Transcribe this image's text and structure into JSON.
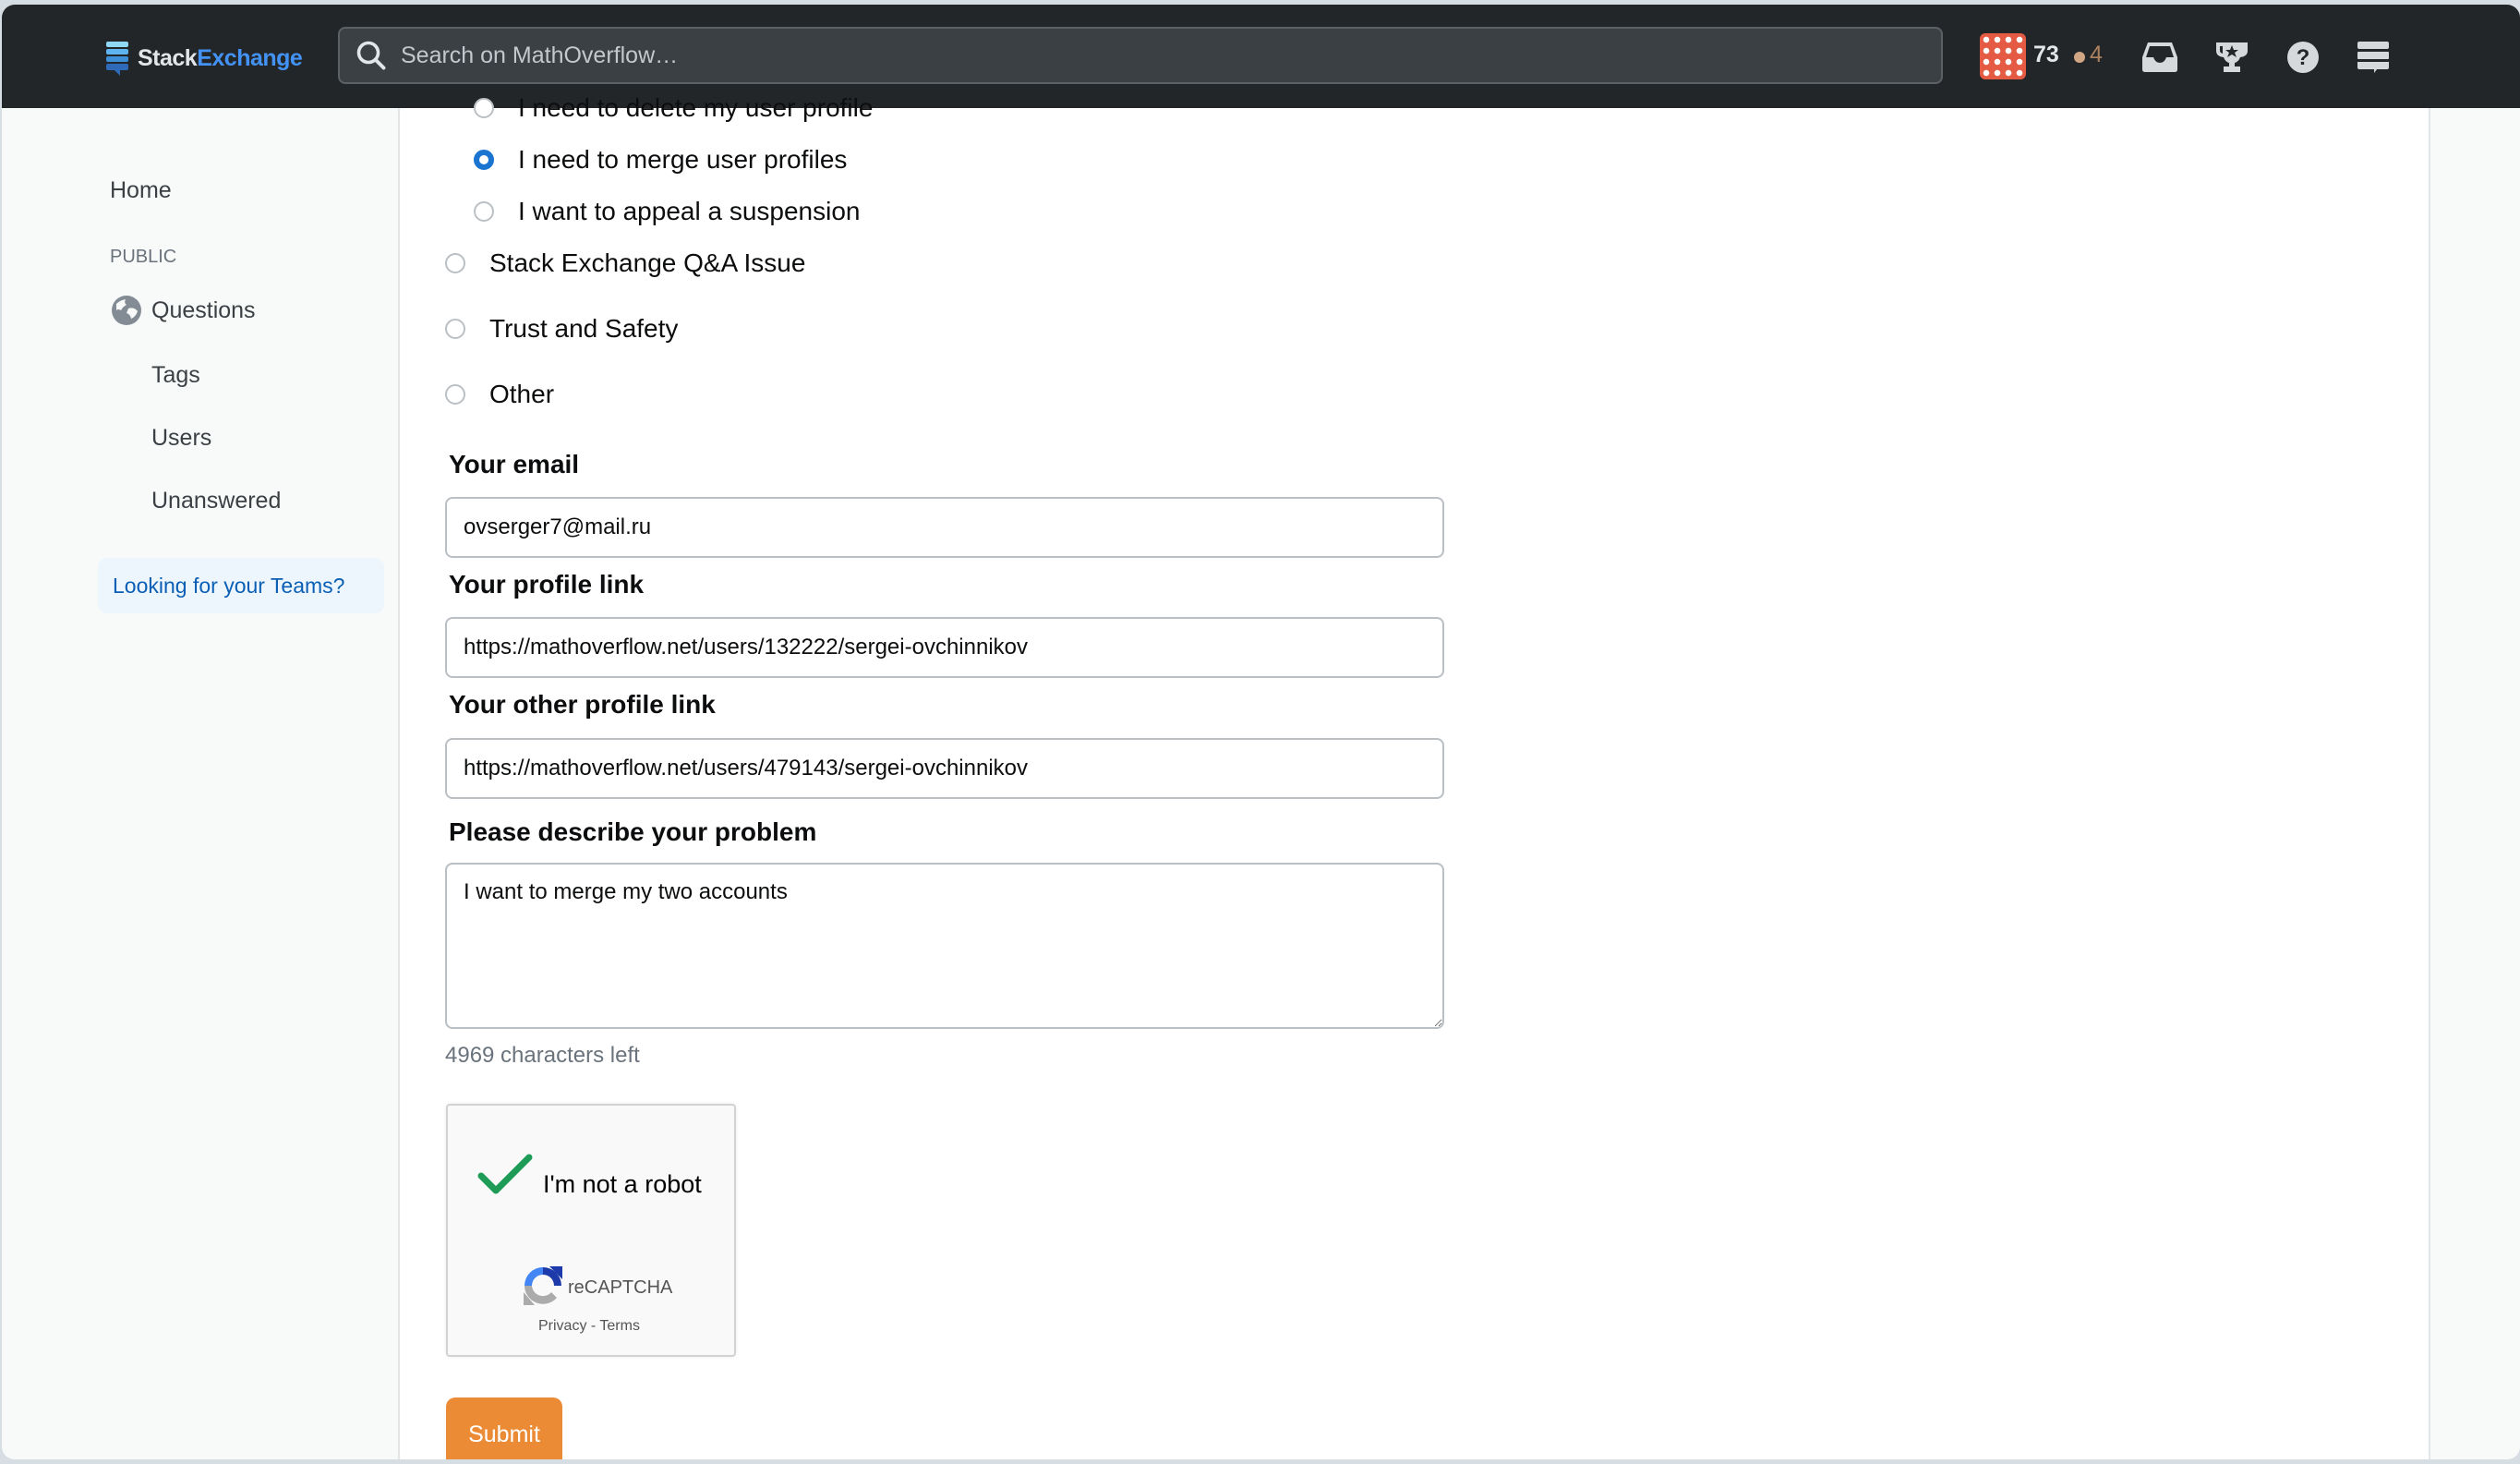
{
  "header": {
    "logo": {
      "part1": "Stack",
      "part2": "Exchange"
    },
    "search_placeholder": "Search on MathOverflow…",
    "user": {
      "reputation": "73",
      "bronze_badges": "4"
    },
    "icons": [
      "inbox-icon",
      "achievements-icon",
      "help-icon",
      "site-switcher-icon"
    ]
  },
  "sidebar": {
    "home": "Home",
    "section_label": "PUBLIC",
    "questions": "Questions",
    "items": [
      "Tags",
      "Users",
      "Unanswered"
    ],
    "teams_link": "Looking for your Teams?"
  },
  "form": {
    "sub_options": [
      {
        "label": "I need to delete my user profile",
        "checked": false
      },
      {
        "label": "I need to merge user profiles",
        "checked": true
      },
      {
        "label": "I want to appeal a suspension",
        "checked": false
      }
    ],
    "top_options": [
      {
        "label": "Stack Exchange Q&A Issue",
        "checked": false
      },
      {
        "label": "Trust and Safety",
        "checked": false
      },
      {
        "label": "Other",
        "checked": false
      }
    ],
    "email": {
      "label": "Your email",
      "value": "ovserger7@mail.ru"
    },
    "profile_link": {
      "label": "Your profile link",
      "value": "https://mathoverflow.net/users/132222/sergei-ovchinnikov"
    },
    "other_profile_link": {
      "label": "Your other profile link",
      "value": "https://mathoverflow.net/users/479143/sergei-ovchinnikov"
    },
    "problem": {
      "label": "Please describe your problem",
      "value": "I want to merge my two accounts"
    },
    "chars_left": "4969 characters left",
    "captcha": {
      "label": "I'm not a robot",
      "brand": "reCAPTCHA",
      "privacy": "Privacy",
      "separator": " - ",
      "terms": "Terms",
      "verified": true
    },
    "submit_label": "Submit"
  },
  "colors": {
    "header_bg": "#232629",
    "accent_blue": "#1b75d0",
    "submit_orange": "#ec8b35",
    "avatar_red": "#e45a42",
    "bronze": "#d1a684"
  }
}
